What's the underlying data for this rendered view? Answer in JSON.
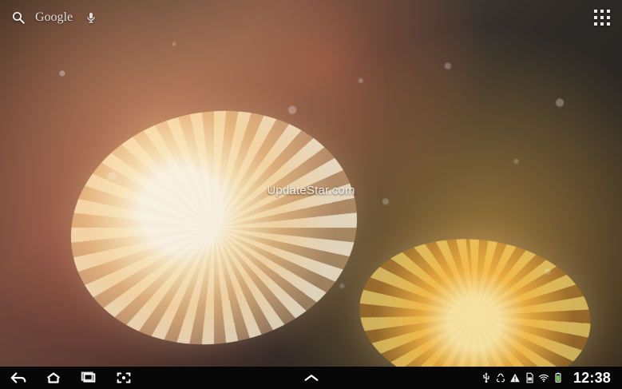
{
  "top": {
    "search_brand": "Google"
  },
  "watermark": {
    "text": "UpdateStar.com"
  },
  "status_bar": {
    "time": "12:38"
  },
  "icons": {
    "search": "search-icon",
    "mic": "mic-icon",
    "apps": "apps-grid-icon",
    "back": "back-icon",
    "home": "home-icon",
    "recent": "recent-apps-icon",
    "screenshot": "screenshot-icon",
    "up": "up-chevron-icon",
    "usb": "usb-icon",
    "recycle": "recycle-icon",
    "warning": "warning-icon",
    "sim": "sim-icon",
    "wifi": "wifi-icon",
    "battery": "battery-icon"
  },
  "colors": {
    "navbar_bg": "#070707",
    "battery_fill": "#7CD84A"
  }
}
